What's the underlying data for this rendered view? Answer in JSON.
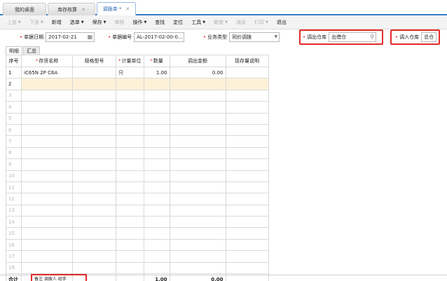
{
  "tabs": [
    {
      "label": "我的桌面",
      "closable": false
    },
    {
      "label": "库存核算",
      "closable": true
    },
    {
      "label": "调拨单 *",
      "closable": true,
      "active": true
    }
  ],
  "toolbar": [
    {
      "label": "上张",
      "dropdown": true,
      "disabled": true
    },
    {
      "label": "下张",
      "dropdown": true,
      "disabled": true
    },
    {
      "label": "新增",
      "dropdown": false,
      "disabled": false
    },
    {
      "label": "选单",
      "dropdown": true,
      "disabled": false
    },
    {
      "label": "保存",
      "dropdown": true,
      "disabled": false
    },
    {
      "label": "审核",
      "dropdown": false,
      "disabled": true
    },
    {
      "label": "操作",
      "dropdown": true,
      "disabled": false
    },
    {
      "label": "查找",
      "dropdown": false,
      "disabled": false
    },
    {
      "label": "定位",
      "dropdown": false,
      "disabled": false
    },
    {
      "label": "工具",
      "dropdown": true,
      "disabled": false
    },
    {
      "label": "联查",
      "dropdown": true,
      "disabled": true
    },
    {
      "label": "消息",
      "dropdown": false,
      "disabled": true
    },
    {
      "label": "打印",
      "dropdown": true,
      "disabled": true
    },
    {
      "label": "退出",
      "dropdown": false,
      "disabled": false
    }
  ],
  "form": {
    "date_label": "单据日期",
    "date_value": "2017-02-21",
    "code_label": "单据编号",
    "code_value": "AL-2017-02-00-0...",
    "biztype_label": "业务类型",
    "biztype_value": "同价调拨",
    "out_wh_label": "调出仓库",
    "out_wh_value": "出借仓",
    "in_wh_label": "调入仓库",
    "in_wh_value": "总仓"
  },
  "subtabs": [
    "明细",
    "汇总"
  ],
  "grid": {
    "headers": [
      "序号",
      "存货名称",
      "规格型号",
      "计量单位",
      "数量",
      "调出金额",
      "现存量说明"
    ],
    "required": [
      false,
      true,
      false,
      true,
      true,
      false,
      false
    ],
    "rows": [
      {
        "no": "1",
        "name": "iC65N 2P C6A",
        "spec": "",
        "unit": "只",
        "qty": "1.00",
        "amount": "0.00",
        "stock": ""
      },
      {
        "no": "2",
        "name": "",
        "spec": "",
        "unit": "",
        "qty": "",
        "amount": "",
        "stock": ""
      },
      {
        "no": "3"
      },
      {
        "no": "4"
      },
      {
        "no": "5"
      },
      {
        "no": "6"
      },
      {
        "no": "7"
      },
      {
        "no": "8"
      },
      {
        "no": "9"
      },
      {
        "no": "10"
      },
      {
        "no": "11"
      },
      {
        "no": "12"
      },
      {
        "no": "13"
      },
      {
        "no": "14"
      },
      {
        "no": "15"
      },
      {
        "no": "16"
      },
      {
        "no": "17"
      },
      {
        "no": "18"
      }
    ],
    "total": {
      "label": "合计",
      "qty": "1.00",
      "amount": "0.00"
    }
  },
  "footer": {
    "text": "备注 调拨人 经手"
  }
}
